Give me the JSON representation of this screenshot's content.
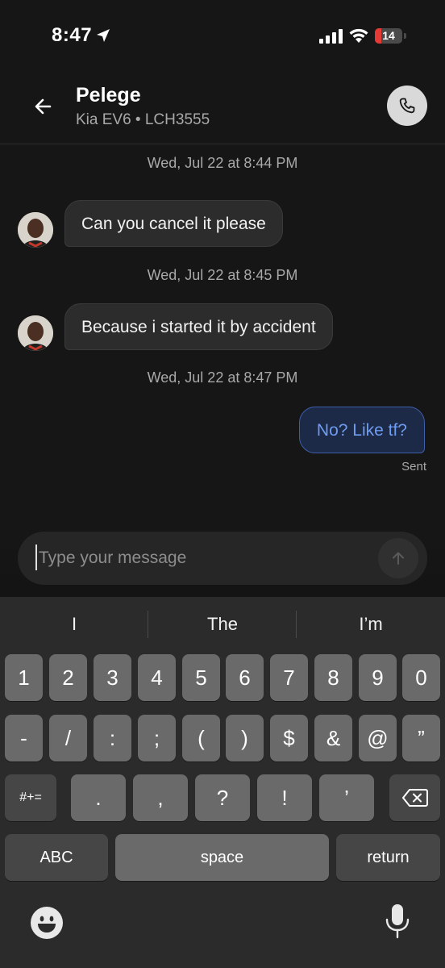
{
  "status_bar": {
    "time": "8:47",
    "battery_level": "14",
    "battery_fraction": 0.14,
    "battery_color": "#e53935"
  },
  "header": {
    "contact_name": "Pelege",
    "vehicle": "Kia EV6 • LCH3555",
    "back_icon": "back-arrow-icon",
    "call_icon": "phone-icon"
  },
  "conversation": {
    "items": [
      {
        "type": "timestamp",
        "text": "Wed, Jul 22 at 8:44 PM"
      },
      {
        "type": "incoming",
        "text": "Can you cancel it please"
      },
      {
        "type": "timestamp",
        "text": "Wed, Jul 22 at 8:45 PM"
      },
      {
        "type": "incoming",
        "text": "Because i started it by accident"
      },
      {
        "type": "timestamp",
        "text": "Wed, Jul 22 at 8:47 PM"
      },
      {
        "type": "outgoing",
        "text": "No? Like tf?",
        "status": "Sent"
      }
    ]
  },
  "composer": {
    "placeholder": "Type your message",
    "value": "",
    "send_icon": "arrow-up-icon"
  },
  "keyboard": {
    "suggestions": [
      "I",
      "The",
      "I’m"
    ],
    "row1": [
      "1",
      "2",
      "3",
      "4",
      "5",
      "6",
      "7",
      "8",
      "9",
      "0"
    ],
    "row2": [
      "-",
      "/",
      ":",
      ";",
      "(",
      ")",
      "$",
      "&",
      "@",
      "”"
    ],
    "row3_toggle": "#+=",
    "row3": [
      ".",
      ",",
      "?",
      "!",
      "’"
    ],
    "backspace_icon": "backspace-icon",
    "abc_label": "ABC",
    "space_label": "space",
    "return_label": "return",
    "emoji_icon": "emoji-icon",
    "mic_icon": "microphone-icon"
  }
}
